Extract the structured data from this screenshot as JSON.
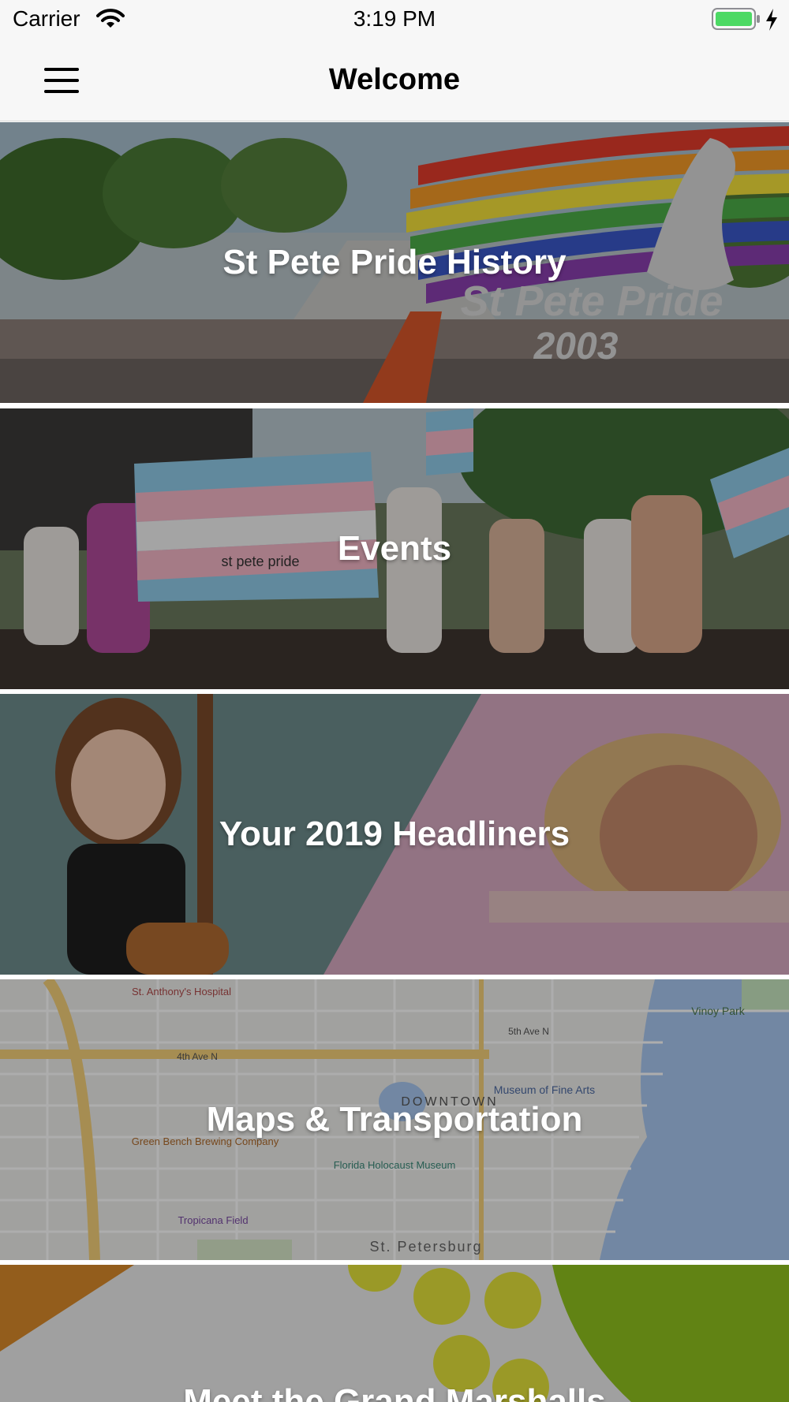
{
  "status_bar": {
    "carrier": "Carrier",
    "time": "3:19 PM",
    "icons": [
      "wifi-icon",
      "battery-icon",
      "charging-bolt-icon"
    ]
  },
  "nav": {
    "title": "Welcome",
    "menu_icon": "hamburger-menu-icon"
  },
  "tiles": [
    {
      "label": "St Pete Pride History",
      "image": "pride-parade-2003-photo"
    },
    {
      "label": "Events",
      "image": "transgender-flag-march-photo"
    },
    {
      "label": "Your 2019 Headliners",
      "image": "headliners-duo-photo"
    },
    {
      "label": "Maps & Transportation",
      "image": "downtown-st-petersburg-map"
    },
    {
      "label": "Meet the Grand Marshalls",
      "image": "grand-marshalls-graphic"
    }
  ],
  "map_labels": {
    "downtown": "DOWNTOWN",
    "city": "St. Petersburg",
    "museum": "Museum of Fine Arts",
    "park": "Vinoy Park",
    "hospital": "St. Anthony's Hospital",
    "fourth_ave": "4th Ave N",
    "fifth_ave": "5th Ave N",
    "tropicana": "Tropicana Field",
    "green_bench": "Green Bench Brewing Company",
    "holocaust": "Florida Holocaust Museum"
  },
  "photo_text": {
    "flag_text": "st pete pride",
    "banner_text": "St Pete Pride",
    "year_text": "2003"
  },
  "colors": {
    "overlay": "rgba(0,0,0,0.32)",
    "nav_bg": "#f7f7f7",
    "battery_green": "#4cd964"
  }
}
